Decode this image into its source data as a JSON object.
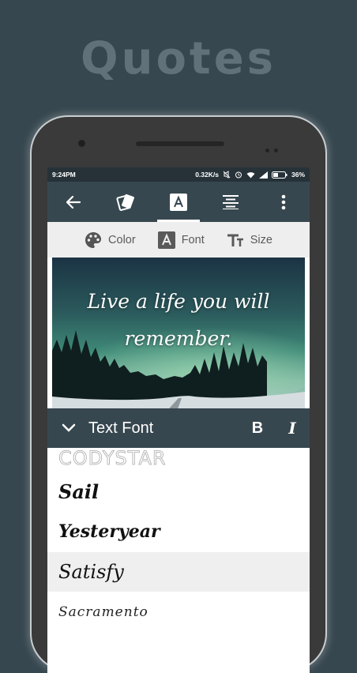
{
  "promo": {
    "title": "Quotes"
  },
  "status_bar": {
    "time": "9:24PM",
    "network_speed": "0.32K/s",
    "battery": "36%",
    "icons": [
      "mute-icon",
      "alarm-icon",
      "wifi-icon",
      "signal-icon",
      "battery-icon"
    ]
  },
  "toolbar": {
    "items": [
      {
        "icon": "back-arrow-icon"
      },
      {
        "icon": "cards-icon"
      },
      {
        "icon": "font-a-icon",
        "active": true
      },
      {
        "icon": "align-center-icon"
      },
      {
        "icon": "more-vert-icon"
      }
    ]
  },
  "subtabs": [
    {
      "label": "Color",
      "icon": "palette-icon"
    },
    {
      "label": "Font",
      "icon": "font-a-icon"
    },
    {
      "label": "Size",
      "icon": "text-size-icon"
    }
  ],
  "preview": {
    "quote_line1": "Live a life you will",
    "quote_line2": "remember."
  },
  "font_panel": {
    "title": "Text Font",
    "bold_label": "B",
    "italic_label": "I",
    "fonts": [
      "CODYSTAR",
      "Sail",
      "Yesteryear",
      "Satisfy",
      "Sacramento"
    ],
    "selected": "Satisfy"
  },
  "colors": {
    "background": "#37474f",
    "toolbar": "#37474f",
    "statusbar": "#263238",
    "subtab_bg": "#eeeeee"
  }
}
